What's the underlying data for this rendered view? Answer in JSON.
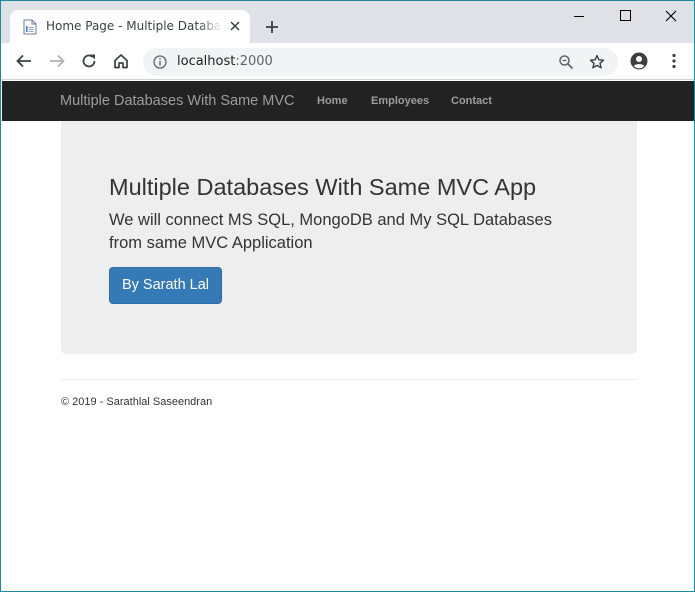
{
  "browser": {
    "tab_title": "Home Page - Multiple Databases With Same MVC",
    "url_host": "localhost",
    "url_port": ":2000",
    "icons": [
      "page-favicon",
      "close-icon",
      "plus-icon",
      "minimize-icon",
      "maximize-icon",
      "close-window-icon",
      "back-arrow-icon",
      "forward-arrow-icon",
      "reload-icon",
      "home-icon",
      "info-icon",
      "zoom-icon",
      "star-icon",
      "account-icon",
      "kebab-menu-icon"
    ]
  },
  "navbar": {
    "brand": "Multiple Databases With Same MVC",
    "links": [
      "Home",
      "Employees",
      "Contact"
    ]
  },
  "jumbotron": {
    "title": "Multiple Databases With Same MVC App",
    "lead": "We will connect MS SQL, MongoDB and My SQL Databases from same MVC Application",
    "button_label": "By Sarath Lal"
  },
  "footer": {
    "text": "© 2019 - Sarathlal Saseendran"
  },
  "colors": {
    "navbar_bg": "#222222",
    "jumbotron_bg": "#eeeeee",
    "primary_button": "#337ab7"
  }
}
